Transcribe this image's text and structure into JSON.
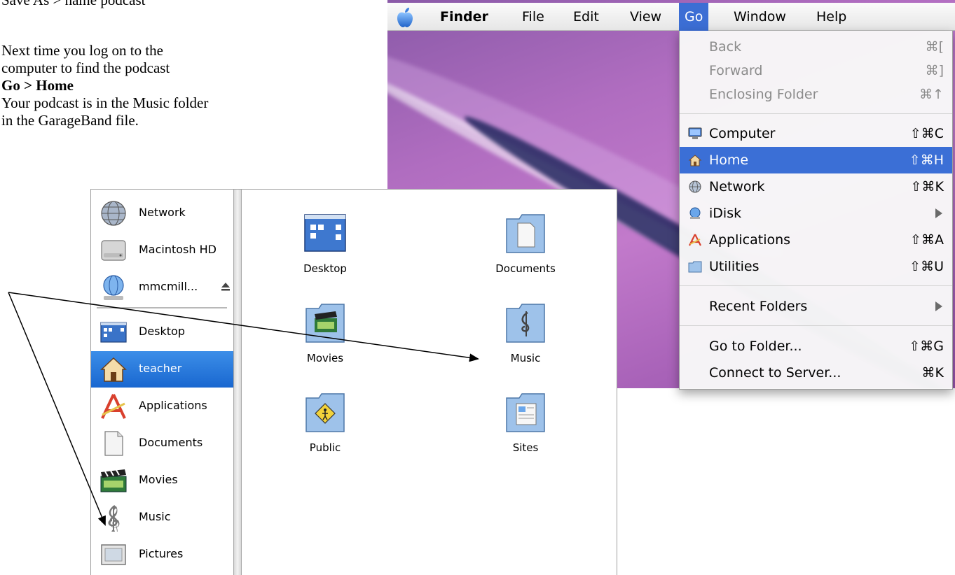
{
  "instructions": {
    "cut_line": "Save As > name podcast",
    "lines": [
      "Next time you log on to the",
      "computer to find the podcast",
      "Go > Home",
      "Your podcast is in the Music folder",
      "in the GarageBand file."
    ]
  },
  "menubar": {
    "app_name": "Finder",
    "items": [
      "File",
      "Edit",
      "View",
      "Go",
      "Window",
      "Help"
    ],
    "active_item": "Go"
  },
  "go_menu": {
    "items": [
      {
        "label": "Back",
        "shortcut": "⌘[",
        "state": "disabled"
      },
      {
        "label": "Forward",
        "shortcut": "⌘]",
        "state": "disabled"
      },
      {
        "label": "Enclosing Folder",
        "shortcut": "⌘↑",
        "state": "disabled"
      },
      {
        "label": "Computer",
        "shortcut": "⇧⌘C",
        "icon": "computer-icon"
      },
      {
        "label": "Home",
        "shortcut": "⇧⌘H",
        "icon": "home-icon",
        "state": "selected"
      },
      {
        "label": "Network",
        "shortcut": "⇧⌘K",
        "icon": "network-icon"
      },
      {
        "label": "iDisk",
        "shortcut": "",
        "icon": "idisk-icon",
        "submenu": true
      },
      {
        "label": "Applications",
        "shortcut": "⇧⌘A",
        "icon": "applications-icon"
      },
      {
        "label": "Utilities",
        "shortcut": "⇧⌘U",
        "icon": "utilities-folder-icon"
      },
      {
        "label": "Recent Folders",
        "shortcut": "",
        "submenu": true
      },
      {
        "label": "Go to Folder...",
        "shortcut": "⇧⌘G"
      },
      {
        "label": "Connect to Server...",
        "shortcut": "⌘K"
      }
    ]
  },
  "sidebar": {
    "devices": [
      {
        "label": "Network",
        "icon": "network-globe-icon"
      },
      {
        "label": "Macintosh HD",
        "icon": "hard-drive-icon"
      },
      {
        "label": "mmcmill... ",
        "icon": "idisk-globe-icon",
        "eject": true
      }
    ],
    "places": [
      {
        "label": "Desktop",
        "icon": "desktop-icon"
      },
      {
        "label": "teacher",
        "icon": "home-house-icon",
        "selected": true
      },
      {
        "label": "Applications",
        "icon": "applications-icon"
      },
      {
        "label": "Documents",
        "icon": "document-icon"
      },
      {
        "label": "Movies",
        "icon": "clapperboard-icon"
      },
      {
        "label": "Music",
        "icon": "treble-clef-icon"
      },
      {
        "label": "Pictures",
        "icon": "picture-frame-icon"
      }
    ]
  },
  "folders": [
    {
      "label": "Desktop",
      "icon": "desktop-folder-icon"
    },
    {
      "label": "Documents",
      "icon": "documents-folder-icon"
    },
    {
      "label": "Movies",
      "icon": "movies-folder-icon"
    },
    {
      "label": "Music",
      "icon": "music-folder-icon"
    },
    {
      "label": "Public",
      "icon": "public-folder-icon"
    },
    {
      "label": "Sites",
      "icon": "sites-folder-icon"
    }
  ],
  "colors": {
    "selection_blue": "#3b6fd6",
    "sidebar_selection": "#1967d0",
    "folder_blue": "#8fb6e0"
  }
}
